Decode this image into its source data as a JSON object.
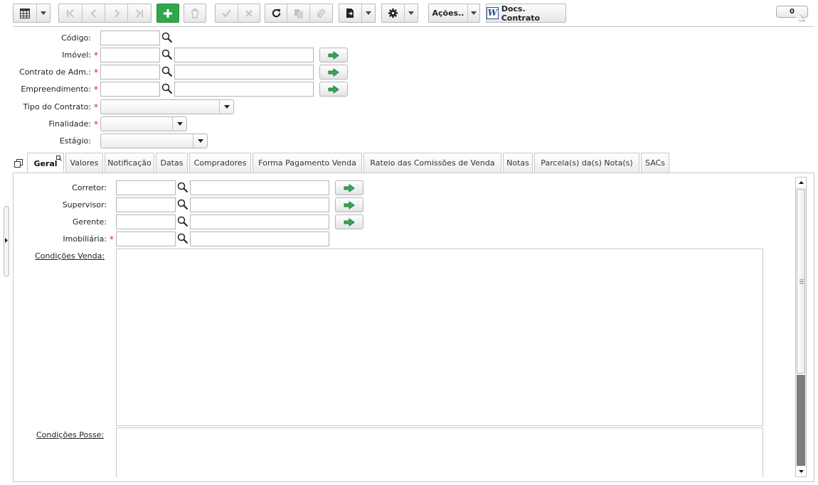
{
  "toolbar": {
    "acoes_label": "Ações..",
    "docs_label": "Docs. Contrato",
    "counter": "0"
  },
  "icons": {
    "grid": "grid-icon",
    "first": "first-record-icon",
    "prev": "prev-record-icon",
    "next": "next-record-icon",
    "last": "last-record-icon",
    "add": "plus-icon",
    "delete": "trash-icon",
    "confirm": "check-icon",
    "cancel": "close-icon",
    "refresh": "refresh-icon",
    "copy": "copy-icon",
    "attach": "paperclip-icon",
    "export": "export-document-icon",
    "settings": "gear-icon",
    "word": "word-icon",
    "search": "search-icon",
    "go": "arrow-right-icon"
  },
  "colors": {
    "add_button": "#2ea84a",
    "required": "#dd2222",
    "go_arrow": "#3aa84e"
  },
  "form": {
    "codigo_label": "Código:",
    "imovel_label": "Imóvel:",
    "contrato_adm_label": "Contrato de Adm.:",
    "empreendimento_label": "Empreendimento:",
    "tipo_contrato_label": "Tipo do Contrato:",
    "finalidade_label": "Finalidade:",
    "estagio_label": "Estágio:",
    "required_mark": "*"
  },
  "tabs": [
    {
      "label": "Geral"
    },
    {
      "label": "Valores"
    },
    {
      "label": "Notificação"
    },
    {
      "label": "Datas"
    },
    {
      "label": "Compradores"
    },
    {
      "label": "Forma Pagamento Venda"
    },
    {
      "label": "Rateio das Comissões de Venda"
    },
    {
      "label": "Notas"
    },
    {
      "label": "Parcela(s) da(s) Nota(s)"
    },
    {
      "label": "SACs"
    }
  ],
  "geral": {
    "corretor_label": "Corretor:",
    "supervisor_label": "Supervisor:",
    "gerente_label": "Gerente:",
    "imobiliaria_label": "Imobiliária:",
    "condicoes_venda_label": "Condições Venda:",
    "condicoes_posse_label": "Condições Posse:"
  }
}
